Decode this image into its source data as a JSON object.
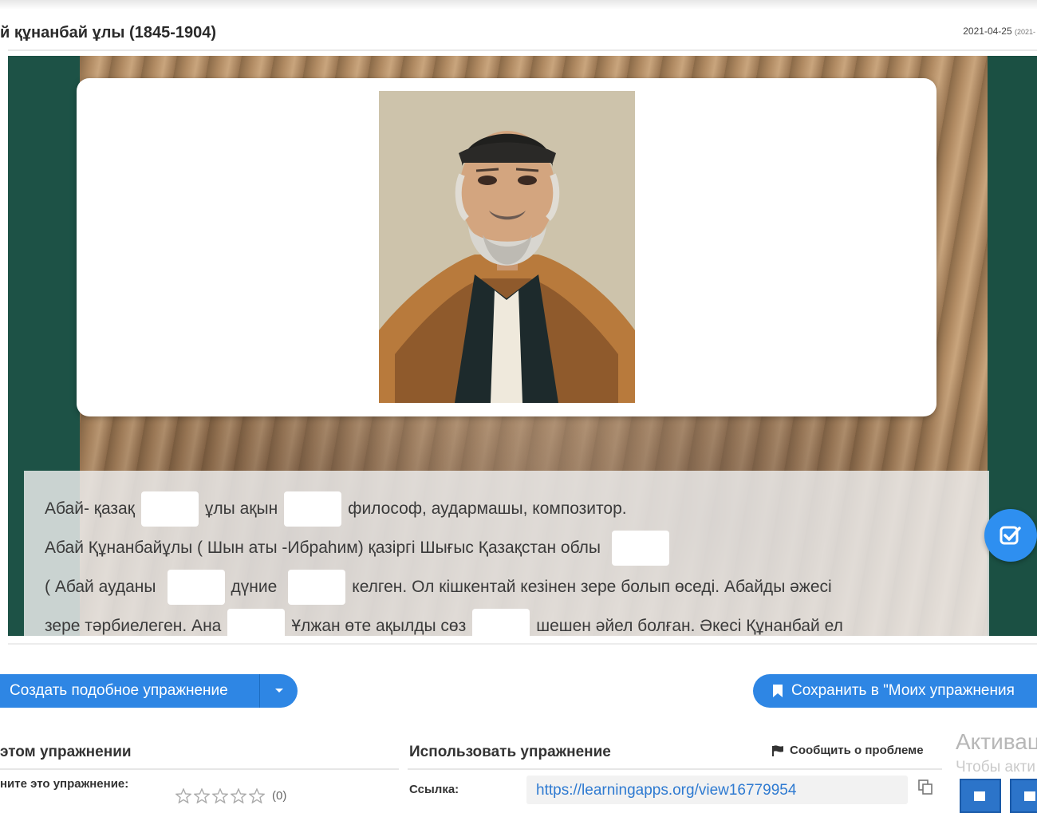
{
  "header": {
    "title": "й құнанбай ұлы (1845-1904)",
    "date": "2021-04-25",
    "date_small": "(2021-"
  },
  "exercise": {
    "lines": [
      [
        "Абай- қазақ",
        "ұлы ақын",
        "философ, аудармашы, композитор."
      ],
      [
        "Абай Құнанбайұлы ( Шын аты -Ибраһим) қазіргі Шығыс Қазақстан облы"
      ],
      [
        "( Абай ауданы",
        "дүние",
        "келген. Ол кішкентай кезінен зере болып өседі. Абайды әжесі"
      ],
      [
        "зере тәрбиелеген. Ана",
        "Ұлжан өте ақылды сөз",
        "шешен әйел болған. Әкесі Құнанбай ел"
      ]
    ]
  },
  "buttons": {
    "create_label": "Создать подобное упражнение",
    "save_label": "Сохранить в \"Моих упражнения"
  },
  "about": {
    "title": "этом упражнении",
    "rate_label": "ните это упражнение:",
    "rating_count": "(0)"
  },
  "use": {
    "title": "Использовать упражнение",
    "report_label": "Сообщить о проблеме",
    "link_label": "Ссылка:",
    "link_url": "https://learningapps.org/view16779954"
  },
  "watermark": {
    "title": "Активац",
    "subtitle": "Чтобы акти"
  },
  "colors": {
    "accent": "#2e86e4",
    "frame": "#1d5246",
    "link": "#2e7ad1"
  }
}
